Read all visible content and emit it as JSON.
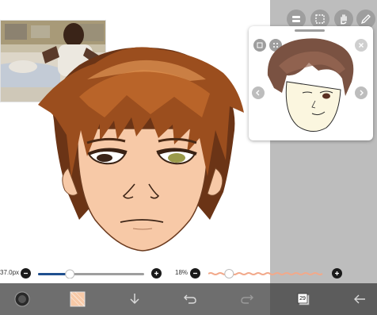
{
  "workspace": {
    "grey_color": "#bdbdbd"
  },
  "reference_photo": {
    "icon": "reference-photo"
  },
  "toolbar": {
    "tools": [
      {
        "name": "layer-tool",
        "icon": "layers-icon"
      },
      {
        "name": "select-tool",
        "icon": "selection-icon"
      },
      {
        "name": "hand-tool",
        "icon": "hand-icon"
      },
      {
        "name": "pen-tool",
        "icon": "pen-icon"
      }
    ]
  },
  "preview": {
    "icons": [
      "frame-icon",
      "grid-icon",
      "close-icon",
      "prev-icon",
      "next-icon"
    ]
  },
  "brush": {
    "size_label": "37.0px",
    "size_level": 0.3,
    "opacity_label": "18%",
    "opacity_level": 0.18
  },
  "bottom_bar": {
    "layers_count": "29",
    "icons": [
      "brush-preview-icon",
      "color-swatch-icon",
      "download-icon",
      "undo-icon",
      "redo-icon",
      "layers-icon",
      "back-icon"
    ]
  },
  "colors": {
    "accent": "#1f4f8f",
    "hair_dark": "#5a2a12",
    "hair_mid": "#a0501e",
    "skin": "#f7c9a7",
    "opacity_track": "#f2a98a"
  }
}
